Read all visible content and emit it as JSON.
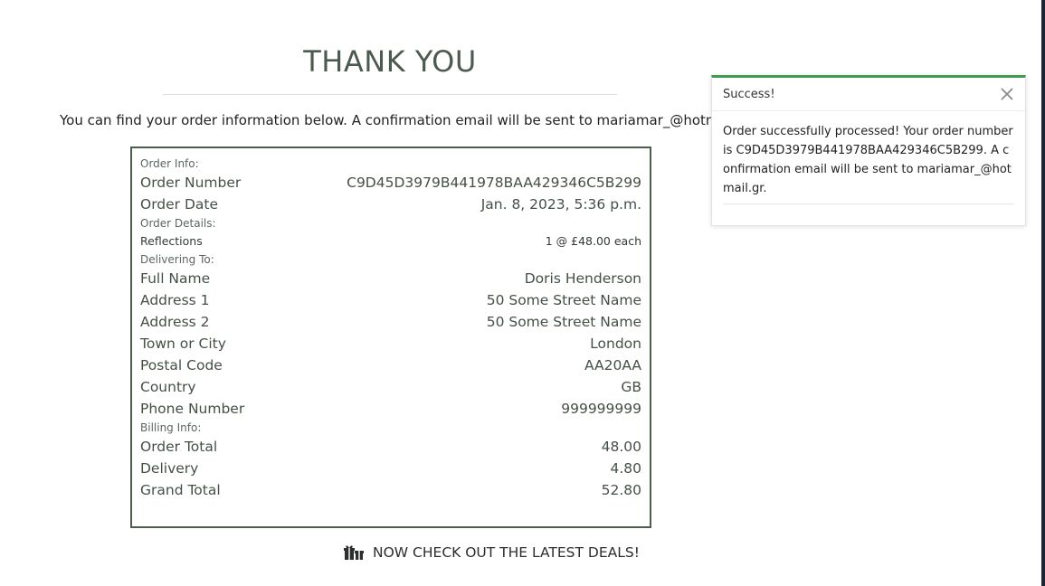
{
  "page": {
    "title": "THANK YOU",
    "intro": "You can find your order information below. A confirmation email will be sent to mariamar_@hotmail.gr."
  },
  "summary": {
    "order_info_label": "Order Info:",
    "order_number_label": "Order Number",
    "order_number": "C9D45D3979B441978BAA429346C5B299",
    "order_date_label": "Order Date",
    "order_date": "Jan. 8, 2023, 5:36 p.m.",
    "order_details_label": "Order Details:",
    "items": [
      {
        "name": "Reflections",
        "qty_price": "1 @ £48.00 each"
      }
    ],
    "delivering_label": "Delivering To:",
    "delivery": {
      "full_name_label": "Full Name",
      "full_name": "Doris Henderson",
      "address1_label": "Address 1",
      "address1": "50 Some Street Name",
      "address2_label": "Address 2",
      "address2": "50 Some Street Name",
      "town_label": "Town or City",
      "town": "London",
      "postal_label": "Postal Code",
      "postal": "AA20AA",
      "country_label": "Country",
      "country": "GB",
      "phone_label": "Phone Number",
      "phone": "999999999"
    },
    "billing_label": "Billing Info:",
    "billing": {
      "order_total_label": "Order Total",
      "order_total": "48.00",
      "delivery_label": "Delivery",
      "delivery": "4.80",
      "grand_total_label": "Grand Total",
      "grand_total": "52.80"
    }
  },
  "deals_link": {
    "label": "NOW CHECK OUT THE LATEST DEALS!",
    "icon": "gifts-icon"
  },
  "toast": {
    "title": "Success!",
    "message": "Order successfully processed! Your order number is C9D45D3979B441978BAA429346C5B299. A confirmation email will be sent to mariamar_@hotmail.gr.",
    "accent_color": "#3f9b4f",
    "close_icon": "close-icon"
  }
}
